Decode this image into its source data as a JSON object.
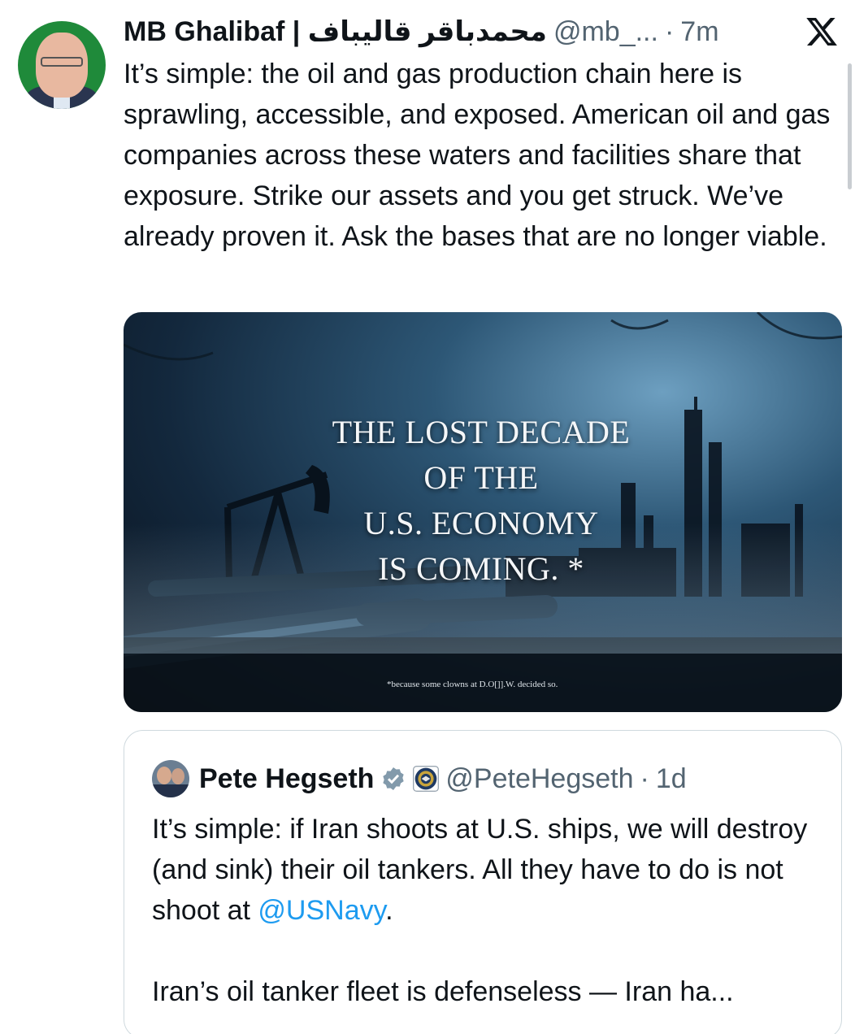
{
  "tweet": {
    "author_name": "MB Ghalibaf | محمدباقر قالیباف",
    "handle": "@mb_...",
    "separator": "·",
    "time": "7m",
    "text": "It’s simple: the oil and gas production chain here is sprawling, accessible, and exposed. American oil and gas companies across these waters and facilities share that exposure. Strike our assets and you get struck. We’ve already proven it. Ask the bases that are no longer viable.",
    "media": {
      "headline_lines": [
        "THE LOST DECADE",
        "OF THE",
        "U.S. ECONOMY",
        "IS COMING. *"
      ],
      "footnote": "*because some clowns at D.O[]].W. decided so."
    }
  },
  "quoted_tweet": {
    "author_name": "Pete Hegseth",
    "handle": "@PeteHegseth",
    "separator": "·",
    "time": "1d",
    "text_before_link": "It’s simple: if Iran shoots at U.S. ships, we will destroy (and sink) their oil tankers. All they have to do is not shoot at ",
    "link": "@USNavy",
    "text_after_link": ".",
    "truncated_line": "Iran’s oil tanker fleet is defenseless — Iran ha..."
  },
  "colors": {
    "text": "#0f1419",
    "secondary": "#536471",
    "link": "#1d9bf0",
    "border": "#cfd9de"
  },
  "icons": [
    "x-logo-icon",
    "verified-badge-icon",
    "department-seal-icon"
  ]
}
